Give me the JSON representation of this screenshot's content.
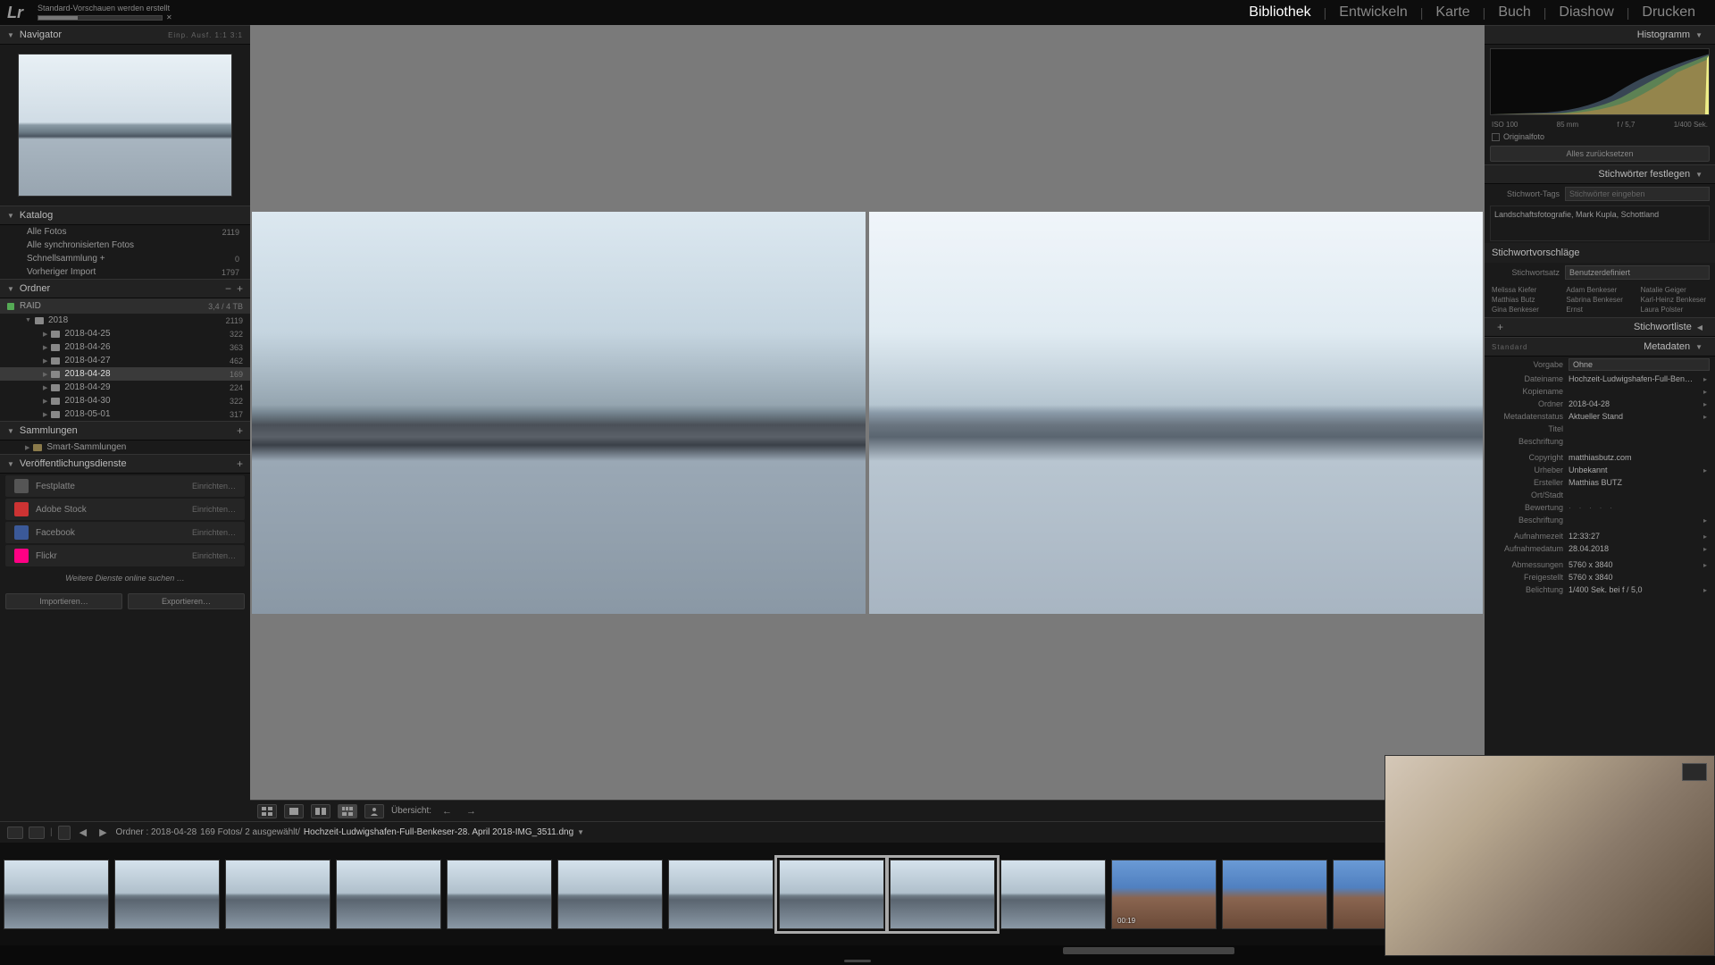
{
  "app": {
    "logo": "Lr"
  },
  "progress": {
    "label": "Standard-Vorschauen werden erstellt"
  },
  "modules": [
    {
      "label": "Bibliothek",
      "active": true
    },
    {
      "label": "Entwickeln"
    },
    {
      "label": "Karte"
    },
    {
      "label": "Buch"
    },
    {
      "label": "Diashow"
    },
    {
      "label": "Drucken"
    }
  ],
  "nav": {
    "title": "Navigator",
    "opts": "Einp.  Ausf.  1:1  3:1"
  },
  "katalog": {
    "title": "Katalog",
    "items": [
      {
        "label": "Alle Fotos",
        "count": "2119"
      },
      {
        "label": "Alle synchronisierten Fotos",
        "count": ""
      },
      {
        "label": "Schnellsammlung  +",
        "count": "0"
      },
      {
        "label": "Vorheriger Import",
        "count": "1797"
      }
    ]
  },
  "ordner": {
    "title": "Ordner",
    "volume": {
      "name": "RAID",
      "stats": "3,4 / 4 TB"
    },
    "year": {
      "name": "2018",
      "count": "2119"
    },
    "folders": [
      {
        "name": "2018-04-25",
        "count": "322"
      },
      {
        "name": "2018-04-26",
        "count": "363"
      },
      {
        "name": "2018-04-27",
        "count": "462"
      },
      {
        "name": "2018-04-28",
        "count": "169",
        "sel": true
      },
      {
        "name": "2018-04-29",
        "count": "224"
      },
      {
        "name": "2018-04-30",
        "count": "322"
      },
      {
        "name": "2018-05-01",
        "count": "317"
      }
    ]
  },
  "samml": {
    "title": "Sammlungen",
    "smart": "Smart-Sammlungen"
  },
  "pub": {
    "title": "Veröffentlichungsdienste",
    "items": [
      {
        "name": "Festplatte",
        "act": "Einrichten…",
        "c": "#555"
      },
      {
        "name": "Adobe Stock",
        "act": "Einrichten…",
        "c": "#c33"
      },
      {
        "name": "Facebook",
        "act": "Einrichten…",
        "c": "#3b5998"
      },
      {
        "name": "Flickr",
        "act": "Einrichten…",
        "c": "#ff0084"
      }
    ],
    "more": "Weitere Dienste online suchen …"
  },
  "btns": {
    "import": "Importieren…",
    "export": "Exportieren…"
  },
  "toolbar": {
    "label": "Übersicht:"
  },
  "histogram": {
    "title": "Histogramm",
    "iso": "ISO 100",
    "focal": "85 mm",
    "ap": "f / 5,7",
    "sh": "1/400 Sek.",
    "orig": "Originalfoto",
    "reset": "Alles zurücksetzen"
  },
  "keywords": {
    "title": "Stichwörter festlegen",
    "tags_lbl": "Stichwort-Tags",
    "tags_ph": "Stichwörter eingeben",
    "tags": "Landschaftsfotografie, Mark Kupla, Schottland",
    "sug_title": "Stichwortvorschläge",
    "set_lbl": "Stichwortsatz",
    "set_val": "Benutzerdefiniert",
    "sugs": [
      "Melissa Kiefer",
      "Adam Benkeser",
      "Natalie Geiger",
      "Matthias Butz",
      "Sabrina Benkeser",
      "Karl-Heinz Benkeser",
      "Gina Benkeser",
      "Ernst",
      "Laura Polster"
    ]
  },
  "kwlist": {
    "title": "Stichwortliste",
    "std": "Standard"
  },
  "metadata": {
    "title": "Metadaten",
    "preset_lbl": "Vorgabe",
    "preset_val": "Ohne",
    "rows": [
      {
        "l": "Dateiname",
        "v": "Hochzeit-Ludwigshafen-Full-Benkeser-28. April 2018-IMG_3511.dng",
        "a": true
      },
      {
        "l": "Kopiename",
        "v": "",
        "a": true
      },
      {
        "l": "Ordner",
        "v": "2018-04-28",
        "a": true
      },
      {
        "l": "Metadatenstatus",
        "v": "Aktueller Stand",
        "a": true
      },
      {
        "l": "Titel",
        "v": ""
      },
      {
        "l": "Beschriftung",
        "v": ""
      },
      {
        "l": "",
        "v": ""
      },
      {
        "l": "Copyright",
        "v": "matthiasbutz.com"
      },
      {
        "l": "Urheber",
        "v": "Unbekannt",
        "a": true
      },
      {
        "l": "Ersteller",
        "v": "Matthias BUTZ"
      },
      {
        "l": "Ort/Stadt",
        "v": ""
      },
      {
        "l": "Bewertung",
        "v": "·  ·  ·  ·  ·",
        "stars": true
      },
      {
        "l": "Beschriftung",
        "v": "",
        "a": true
      },
      {
        "l": "",
        "v": ""
      },
      {
        "l": "Aufnahmezeit",
        "v": "12:33:27",
        "a": true
      },
      {
        "l": "Aufnahmedatum",
        "v": "28.04.2018",
        "a": true
      },
      {
        "l": "",
        "v": ""
      },
      {
        "l": "Abmessungen",
        "v": "5760 x 3840",
        "a": true
      },
      {
        "l": "Freigestellt",
        "v": "5760 x 3840"
      },
      {
        "l": "Belichtung",
        "v": "1/400 Sek. bei f / 5,0",
        "a": true
      }
    ]
  },
  "filmbar": {
    "path_folder": "Ordner : 2018-04-28",
    "path_count": "169 Fotos/  2 ausgewählt/",
    "path_file": "Hochzeit-Ludwigshafen-Full-Benkeser-28. April 2018-IMG_3511.dng"
  },
  "thumbs": [
    {
      "c": "land"
    },
    {
      "c": "land"
    },
    {
      "c": "land"
    },
    {
      "c": "land"
    },
    {
      "c": "land"
    },
    {
      "c": "land"
    },
    {
      "c": "land"
    },
    {
      "c": "land",
      "sel": true
    },
    {
      "c": "land",
      "sel": true
    },
    {
      "c": "land"
    },
    {
      "c": "sky",
      "dur": "00:19"
    },
    {
      "c": "sky"
    },
    {
      "c": "sky"
    },
    {
      "c": "dark"
    },
    {
      "c": "dark"
    },
    {
      "c": "dark"
    }
  ]
}
